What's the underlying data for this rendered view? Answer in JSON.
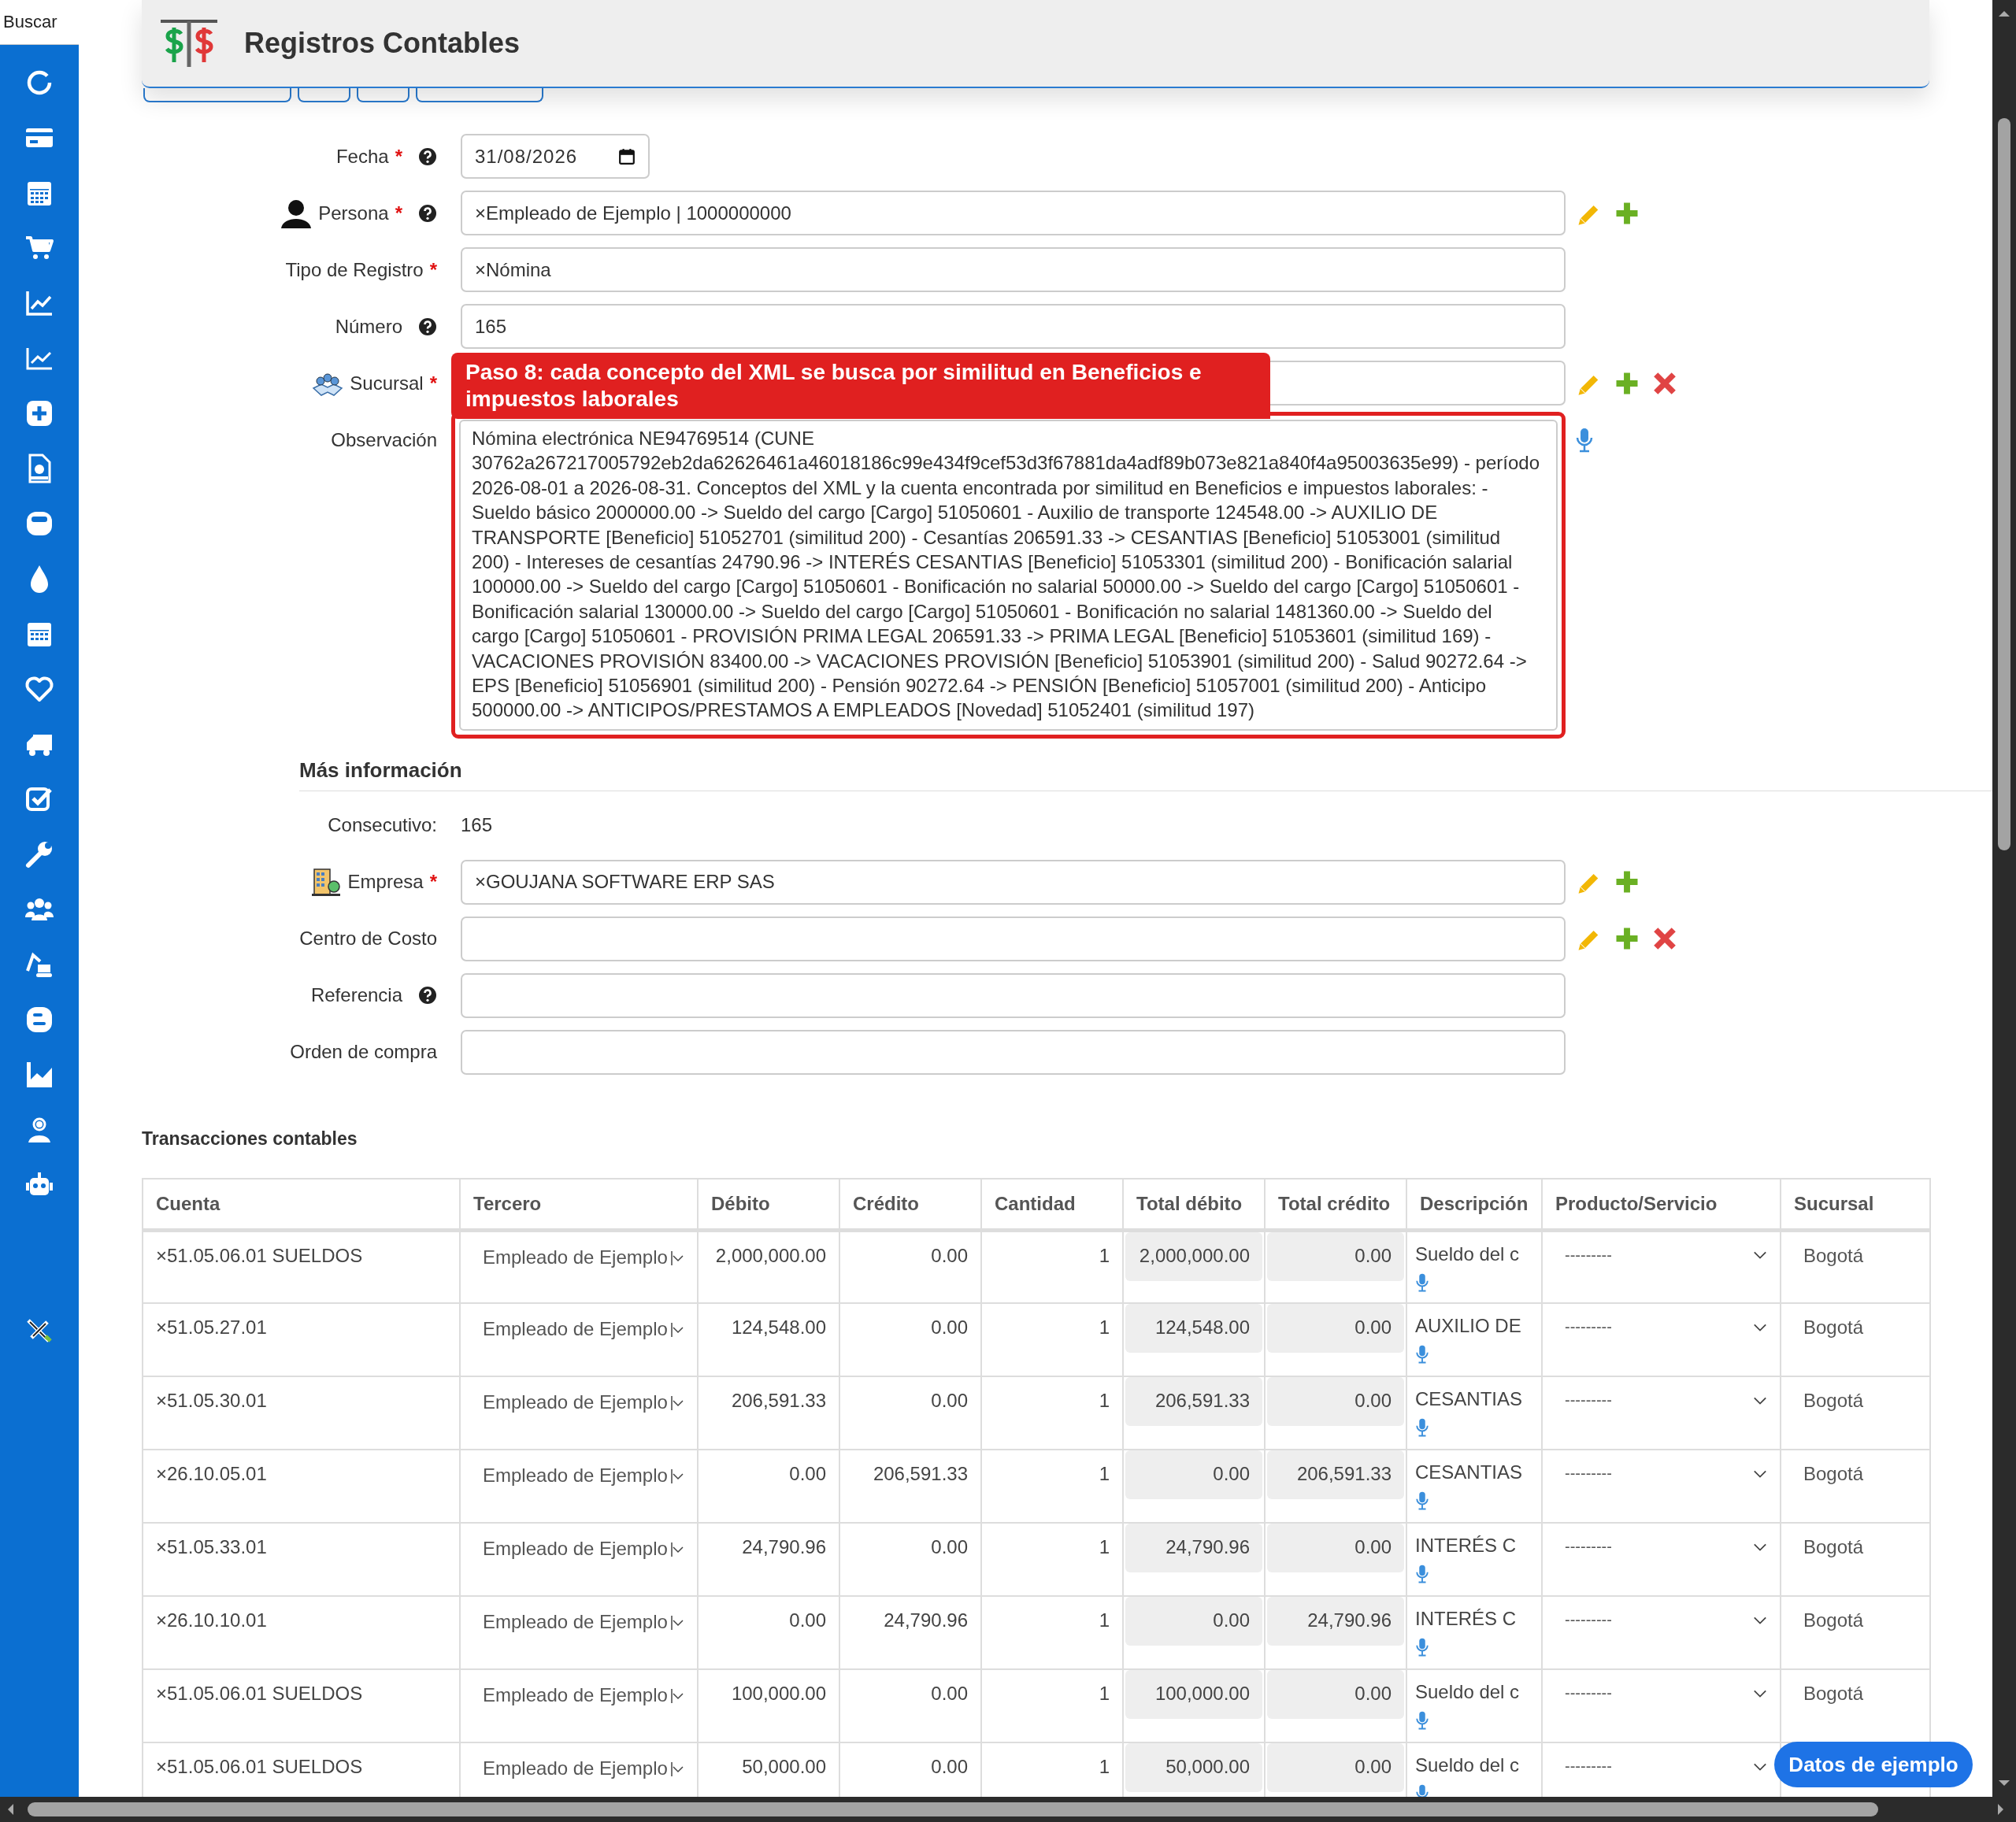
{
  "sidebar": {
    "search_placeholder": "Buscar"
  },
  "header": {
    "title": "Registros Contables"
  },
  "form": {
    "fields": [
      {
        "label": "Fecha",
        "required_mark": "*",
        "help": true,
        "kind": "date",
        "value": "31/08/2026"
      },
      {
        "label": "Persona",
        "required_mark": "*",
        "help": true,
        "kind": "input",
        "value": "×Empleado de Ejemplo | 1000000000"
      },
      {
        "label": "Tipo de Registro",
        "required_mark": "*",
        "help": false,
        "kind": "input",
        "value": "×Nómina"
      },
      {
        "label": "Número",
        "help": true,
        "kind": "input",
        "value": "165"
      },
      {
        "label": "Sucursal",
        "required_mark": "*",
        "help": false,
        "kind": "input"
      },
      {
        "label": "Observación",
        "help": false,
        "kind": "textarea",
        "highlighted": true,
        "callout": "Paso 8: cada concepto del XML se busca por similitud en Beneficios e impuestos laborales",
        "value": "Nómina electrónica NE94769514 (CUNE 30762a267217005792eb2da62626461a46018186c99e434f9cef53d3f67881da4adf89b073e821a840f4a95003635e99) - período 2026-08-01 a 2026-08-31. Conceptos del XML y la cuenta encontrada por similitud en Beneficios e impuestos laborales: - Sueldo básico 2000000.00 -> Sueldo del cargo [Cargo] 51050601 - Auxilio de transporte 124548.00 -> AUXILIO DE TRANSPORTE [Beneficio] 51052701 (similitud 200) - Cesantías 206591.33 -> CESANTIAS [Beneficio] 51053001 (similitud 200) - Intereses de cesantías 24790.96 -> INTERÉS CESANTIAS [Beneficio] 51053301 (similitud 200) - Bonificación salarial 100000.00 -> Sueldo del cargo [Cargo] 51050601 - Bonificación no salarial 50000.00 -> Sueldo del cargo [Cargo] 51050601 - Bonificación salarial 130000.00 -> Sueldo del cargo [Cargo] 51050601 - Bonificación no salarial 1481360.00 -> Sueldo del cargo [Cargo] 51050601 - PROVISIÓN PRIMA LEGAL 206591.33 -> PRIMA LEGAL [Beneficio] 51053601 (similitud 169) - VACACIONES PROVISIÓN 83400.00 -> VACACIONES PROVISIÓN [Beneficio] 51053901 (similitud 200) - Salud 90272.64 -> EPS [Beneficio] 51056901 (similitud 200) - Pensión 90272.64 -> PENSIÓN [Beneficio] 51057001 (similitud 200) - Anticipo 500000.00 -> ANTICIPOS/PRESTAMOS A EMPLEADOS [Novedad] 51052401 (similitud 197)"
      }
    ]
  },
  "more_info": {
    "title": "Más información",
    "consecutive_label": "Consecutivo:",
    "consecutive_value": "165",
    "fields": [
      {
        "label": "Empresa",
        "required_mark": "*",
        "help": false,
        "kind": "input",
        "value": "×GOUJANA SOFTWARE ERP SAS"
      },
      {
        "label": "Centro de Costo",
        "help": false,
        "kind": "input"
      },
      {
        "label": "Referencia",
        "help": true,
        "kind": "input"
      },
      {
        "label": "Orden de compra",
        "help": false,
        "kind": "input"
      }
    ]
  },
  "transactions": {
    "title": "Transacciones contables",
    "columns": [
      "Cuenta",
      "Tercero",
      "Débito",
      "Crédito",
      "Cantidad",
      "Total débito",
      "Total crédito",
      "Descripción",
      "Producto/Servicio",
      "Sucursal"
    ],
    "rows": [
      {
        "cuenta": "×51.05.06.01 SUELDOS",
        "tercero": "Empleado de Ejemplo",
        "debito": "2,000,000.00",
        "credito": "0.00",
        "cantidad": "1",
        "total_debito": "2,000,000.00",
        "total_credito": "0.00",
        "descripcion": "Sueldo del c",
        "producto": "---------",
        "sucursal": "Bogotá"
      },
      {
        "cuenta": "×51.05.27.01",
        "tercero": "Empleado de Ejemplo",
        "debito": "124,548.00",
        "credito": "0.00",
        "cantidad": "1",
        "total_debito": "124,548.00",
        "total_credito": "0.00",
        "descripcion": "AUXILIO DE",
        "producto": "---------",
        "sucursal": "Bogotá"
      },
      {
        "cuenta": "×51.05.30.01",
        "tercero": "Empleado de Ejemplo",
        "debito": "206,591.33",
        "credito": "0.00",
        "cantidad": "1",
        "total_debito": "206,591.33",
        "total_credito": "0.00",
        "descripcion": "CESANTIAS",
        "producto": "---------",
        "sucursal": "Bogotá"
      },
      {
        "cuenta": "×26.10.05.01",
        "tercero": "Empleado de Ejemplo",
        "debito": "0.00",
        "credito": "206,591.33",
        "cantidad": "1",
        "total_debito": "0.00",
        "total_credito": "206,591.33",
        "descripcion": "CESANTIAS",
        "producto": "---------",
        "sucursal": "Bogotá"
      },
      {
        "cuenta": "×51.05.33.01",
        "tercero": "Empleado de Ejemplo",
        "debito": "24,790.96",
        "credito": "0.00",
        "cantidad": "1",
        "total_debito": "24,790.96",
        "total_credito": "0.00",
        "descripcion": "INTERÉS C",
        "producto": "---------",
        "sucursal": "Bogotá"
      },
      {
        "cuenta": "×26.10.10.01",
        "tercero": "Empleado de Ejemplo",
        "debito": "0.00",
        "credito": "24,790.96",
        "cantidad": "1",
        "total_debito": "0.00",
        "total_credito": "24,790.96",
        "descripcion": "INTERÉS C",
        "producto": "---------",
        "sucursal": "Bogotá"
      },
      {
        "cuenta": "×51.05.06.01 SUELDOS",
        "tercero": "Empleado de Ejemplo",
        "debito": "100,000.00",
        "credito": "0.00",
        "cantidad": "1",
        "total_debito": "100,000.00",
        "total_credito": "0.00",
        "descripcion": "Sueldo del c",
        "producto": "---------",
        "sucursal": "Bogotá"
      },
      {
        "cuenta": "×51.05.06.01 SUELDOS",
        "tercero": "Empleado de Ejemplo",
        "debito": "50,000.00",
        "credito": "0.00",
        "cantidad": "1",
        "total_debito": "50,000.00",
        "total_credito": "0.00",
        "descripcion": "Sueldo del c",
        "producto": "---------"
      }
    ]
  },
  "sample_button": {
    "label": "Datos de ejemplo"
  }
}
